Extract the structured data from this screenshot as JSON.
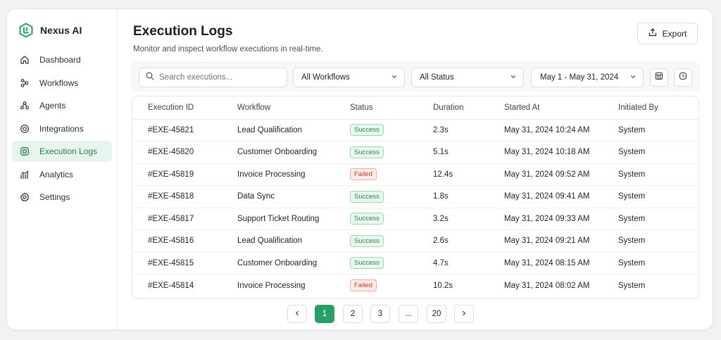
{
  "app": {
    "name": "Nexus AI"
  },
  "sidebar": {
    "items": [
      {
        "label": "Dashboard",
        "icon": "home-icon"
      },
      {
        "label": "Workflows",
        "icon": "workflow-icon"
      },
      {
        "label": "Agents",
        "icon": "agents-icon"
      },
      {
        "label": "Integrations",
        "icon": "integrations-icon"
      },
      {
        "label": "Execution Logs",
        "icon": "execution-logs-icon",
        "active": true
      },
      {
        "label": "Analytics",
        "icon": "analytics-icon"
      },
      {
        "label": "Settings",
        "icon": "gear-icon"
      }
    ]
  },
  "header": {
    "title": "Execution Logs",
    "subtitle": "Monitor and inspect workflow executions in real-time.",
    "export_label": "Export"
  },
  "filters": {
    "search_placeholder": "Search executions...",
    "workflow": "All Workflows",
    "status": "All Status",
    "date_range": "May 1 - May 31, 2024"
  },
  "table": {
    "columns": [
      "Execution ID",
      "Workflow",
      "Status",
      "Duration",
      "Started At",
      "Initiated By"
    ],
    "rows": [
      [
        "#EXE-45821",
        "Lead Qualification",
        "Success",
        "2.3s",
        "May 31, 2024 10:24 AM",
        "System"
      ],
      [
        "#EXE-45820",
        "Customer Onboarding",
        "Success",
        "5.1s",
        "May 31, 2024 10:18 AM",
        "System"
      ],
      [
        "#EXE-45819",
        "Invoice Processing",
        "Failed",
        "12.4s",
        "May 31, 2024 09:52 AM",
        "System"
      ],
      [
        "#EXE-45818",
        "Data Sync",
        "Success",
        "1.8s",
        "May 31, 2024 09:41 AM",
        "System"
      ],
      [
        "#EXE-45817",
        "Support Ticket Routing",
        "Success",
        "3.2s",
        "May 31, 2024 09:33 AM",
        "System"
      ],
      [
        "#EXE-45816",
        "Lead Qualification",
        "Success",
        "2.6s",
        "May 31, 2024 09:21 AM",
        "System"
      ],
      [
        "#EXE-45815",
        "Customer Onboarding",
        "Success",
        "4.7s",
        "May 31, 2024 08:15 AM",
        "System"
      ],
      [
        "#EXE-45814",
        "Invoice Processing",
        "Failed",
        "10.2s",
        "May 31, 2024 08:02 AM",
        "System"
      ]
    ]
  },
  "pagination": {
    "pages": [
      "1",
      "2",
      "3",
      "...",
      "20"
    ],
    "current": "1"
  },
  "colors": {
    "accent": "#27a066",
    "success": "#1f8a4c",
    "failed": "#c0392b"
  }
}
